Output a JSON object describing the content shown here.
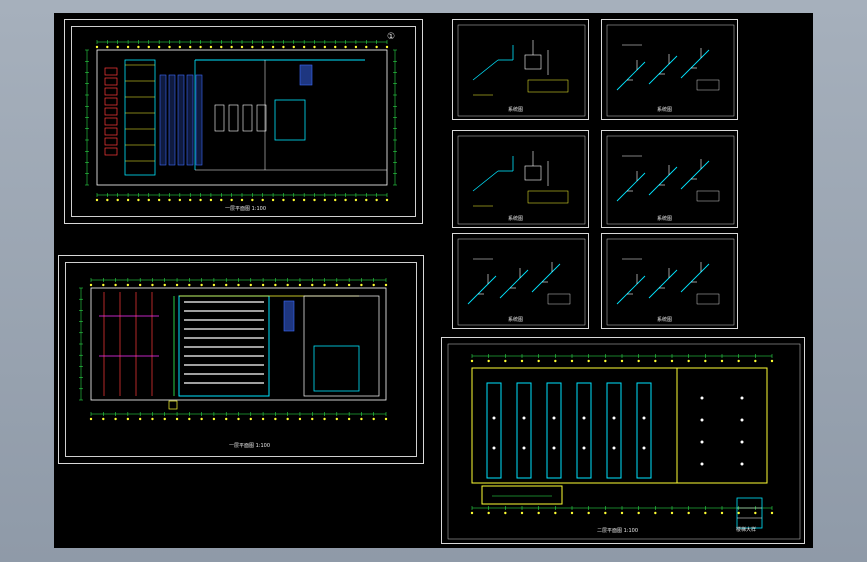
{
  "canvas": {
    "background": "#000000"
  },
  "colors": {
    "frame": "#d8d8d8",
    "cyan": "#00e5ff",
    "yellow": "#ffff33",
    "red": "#ff3b3b",
    "green": "#33ff55",
    "magenta": "#ff33ff",
    "blue": "#3b6bff",
    "white": "#ffffff"
  },
  "sheets": [
    {
      "id": "sheet-1",
      "kind": "floor-plan-upper",
      "caption": "一层平面图 1:100",
      "symbol": "①"
    },
    {
      "id": "sheet-2",
      "kind": "isometric-pump",
      "caption": "系统图"
    },
    {
      "id": "sheet-3",
      "kind": "isometric-pipes",
      "caption": "系统图"
    },
    {
      "id": "sheet-4",
      "kind": "isometric-pump",
      "caption": "系统图"
    },
    {
      "id": "sheet-5",
      "kind": "isometric-pipes",
      "caption": "系统图"
    },
    {
      "id": "sheet-6",
      "kind": "floor-plan-lower",
      "caption": "一层平面图 1:100"
    },
    {
      "id": "sheet-7",
      "kind": "isometric-pipes",
      "caption": "系统图"
    },
    {
      "id": "sheet-8",
      "kind": "isometric-pipes",
      "caption": "系统图"
    },
    {
      "id": "sheet-9",
      "kind": "floor-plan-right",
      "caption": "二层平面图 1:100",
      "sub_caption": "楼梯大样"
    }
  ]
}
